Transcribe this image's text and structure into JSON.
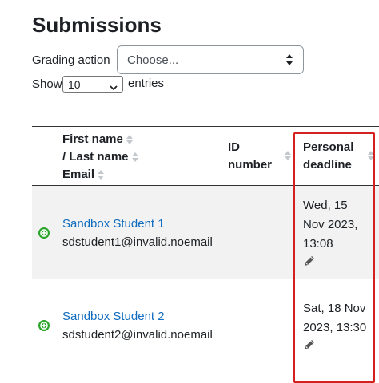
{
  "page": {
    "title": "Submissions"
  },
  "grading": {
    "label": "Grading action",
    "select_value": "Choose..."
  },
  "show": {
    "label": "Show",
    "value": "10",
    "suffix": "entries"
  },
  "table": {
    "headers": {
      "name_line1": "First name",
      "name_line2": "/ Last name",
      "name_line3": "Email",
      "id_line1": "ID",
      "id_line2": "number",
      "deadline_line1": "Personal",
      "deadline_line2": "deadline"
    },
    "rows": [
      {
        "name": "Sandbox Student 1",
        "email": "sdstudent1@invalid.noemail",
        "deadline_line1": "Wed, 15",
        "deadline_line2": "Nov 2023,",
        "deadline_line3": "13:08"
      },
      {
        "name": "Sandbox Student 2",
        "email": "sdstudent2@invalid.noemail",
        "deadline_line1": "Sat, 18 Nov",
        "deadline_line2": "2023, 13:30"
      }
    ]
  },
  "icons": {
    "sort": "sort-icon",
    "expand": "plus-circle-icon",
    "edit": "pencil-icon",
    "select_arrows": "updown-arrows-icon"
  },
  "colors": {
    "link": "#0f6cbf",
    "highlight": "#d32020",
    "expand_icon": "#2aa52a",
    "row_stripe": "#f2f2f2"
  }
}
